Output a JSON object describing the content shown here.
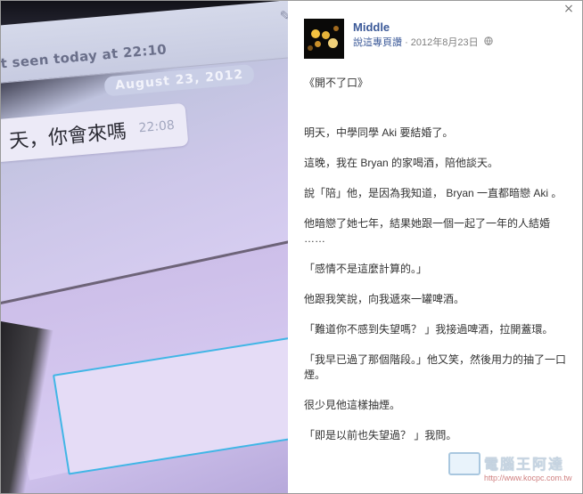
{
  "photo": {
    "last_seen": "t seen today at 22:10",
    "date_pill": "August 23, 2012",
    "bubble_text": "天，你會來嗎",
    "bubble_time": "22:08"
  },
  "post": {
    "close_label": "×",
    "author_name": "Middle",
    "meta_link": "說這專頁讚",
    "meta_sep": "·",
    "meta_date": "2012年8月23日",
    "globe_icon": "globe-icon",
    "paragraphs": [
      "《開不了口》",
      "明天，中學同學 Aki 要結婚了。",
      "這晚，我在 Bryan 的家喝酒，陪他談天。",
      "說「陪」他，是因為我知道， Bryan 一直都暗戀 Aki 。",
      "他暗戀了她七年，結果她跟一個一起了一年的人結婚 ……",
      "「感情不是這麼計算的。」",
      "他跟我笑說，向我遞來一罐啤酒。",
      "「難道你不感到失望嗎？ 」我接過啤酒，拉開蓋環。",
      "「我早已過了那個階段。」他又笑，然後用力的抽了一口煙。",
      "很少見他這樣抽煙。",
      "「即是以前也失望過？ 」我問。"
    ]
  },
  "watermark": {
    "title": "電腦王阿達",
    "url": "http://www.kocpc.com.tw"
  },
  "colors": {
    "link": "#3b5998",
    "meta_gray": "#808080",
    "text": "#333333",
    "input_border": "#41b6e6"
  }
}
